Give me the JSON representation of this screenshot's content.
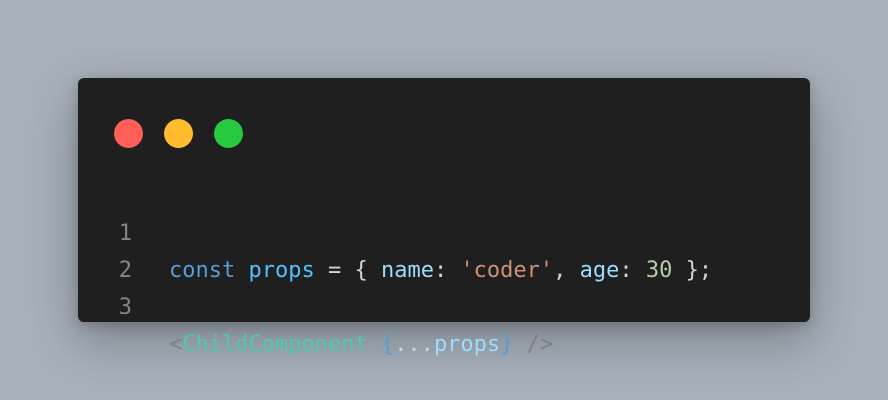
{
  "window_controls": {
    "close_color": "#ff5f56",
    "minimize_color": "#ffbd2e",
    "maximize_color": "#27c93f"
  },
  "code": {
    "line_numbers": [
      "1",
      "2",
      "3"
    ],
    "lines": [
      {
        "tokens": [
          "const",
          " ",
          "props",
          " = { ",
          "name",
          ": ",
          "'coder'",
          ", ",
          "age",
          ": ",
          "30",
          " };"
        ]
      },
      {
        "tokens": []
      },
      {
        "tokens": [
          "<",
          "ChildComponent",
          " ",
          "{",
          "...",
          "props",
          "}",
          " />"
        ]
      }
    ]
  }
}
